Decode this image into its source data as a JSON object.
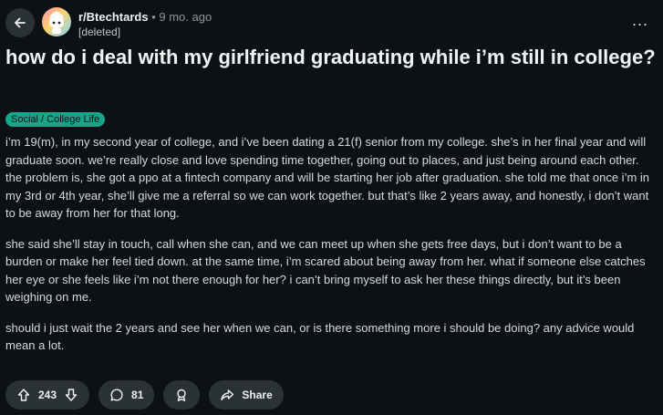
{
  "header": {
    "subreddit": "r/Btechtards",
    "separator": "•",
    "age": "9 mo. ago",
    "author": "[deleted]",
    "more": "..."
  },
  "post": {
    "title": "how do i deal with my girlfriend graduating while i’m still in college?",
    "flair": "Social / College Life",
    "paragraphs": [
      "i’m 19(m), in my second year of college, and i’ve been dating a 21(f) senior from my college. she’s in her final year and will graduate soon. we’re really close and love spending time together, going out to places, and just being around each other. the problem is, she got a ppo at a fintech company and will be starting her job after graduation. she told me that once i’m in my 3rd or 4th year, she’ll give me a referral so we can work together. but that’s like 2 years away, and honestly, i don’t want to be away from her for that long.",
      "she said she’ll stay in touch, call when she can, and we can meet up when she gets free days, but i don’t want to be a burden or make her feel tied down. at the same time, i’m scared about being away from her. what if someone else catches her eye or she feels like i’m not there enough for her? i can’t bring myself to ask her these things directly, but it’s been weighing on me.",
      "should i just wait the 2 years and see her when we can, or is there something more i should be doing? any advice would mean a lot."
    ]
  },
  "actions": {
    "votes": "243",
    "comments": "81",
    "share_label": "Share"
  },
  "icons": {
    "back": "arrow-left-icon",
    "upvote": "arrow-up-icon",
    "downvote": "arrow-down-icon",
    "comment": "comment-bubble-icon",
    "award": "award-icon",
    "share": "share-arrow-icon"
  },
  "colors": {
    "background": "#0e1113",
    "pill": "#2a3236",
    "flair": "#17a589"
  }
}
